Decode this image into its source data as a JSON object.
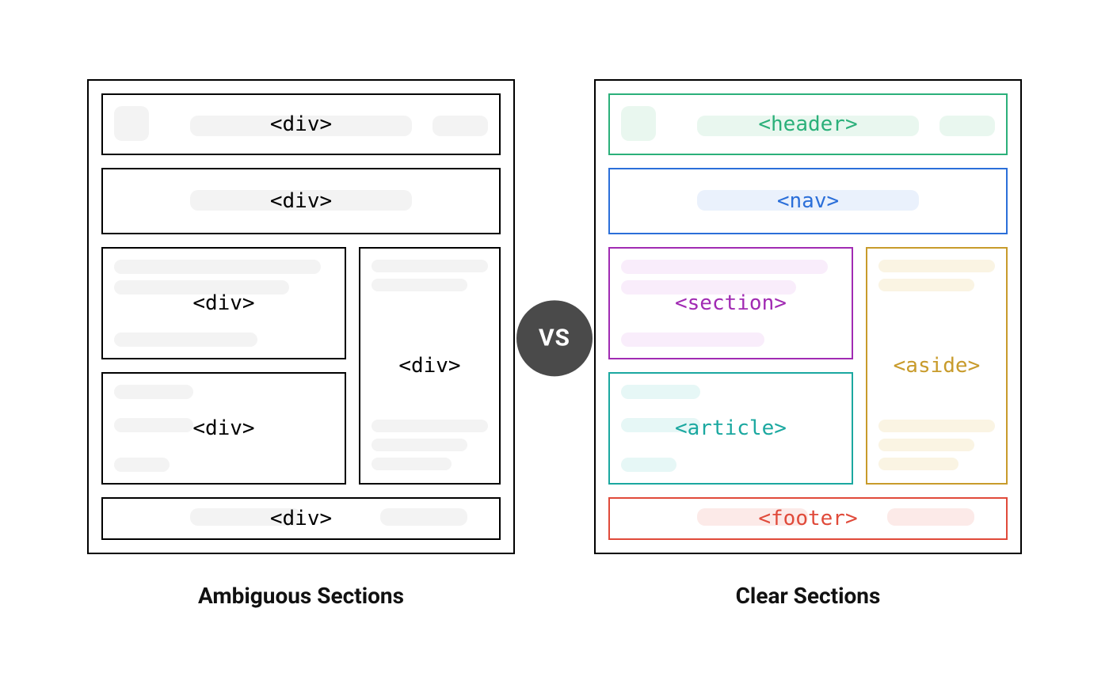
{
  "vs_label": "VS",
  "left": {
    "caption": "Ambiguous Sections",
    "labels": {
      "header": "<div>",
      "nav": "<div>",
      "section": "<div>",
      "article": "<div>",
      "aside": "<div>",
      "footer": "<div>"
    }
  },
  "right": {
    "caption": "Clear Sections",
    "labels": {
      "header": "<header>",
      "nav": "<nav>",
      "section": "<section>",
      "article": "<article>",
      "aside": "<aside>",
      "footer": "<footer>"
    }
  },
  "colors": {
    "header": "#2bb07a",
    "nav": "#2b6fd9",
    "section": "#a12bb3",
    "article": "#1ba8a0",
    "aside": "#c89b2b",
    "footer": "#e04a3a",
    "vs_bg": "#4a4a4a"
  }
}
